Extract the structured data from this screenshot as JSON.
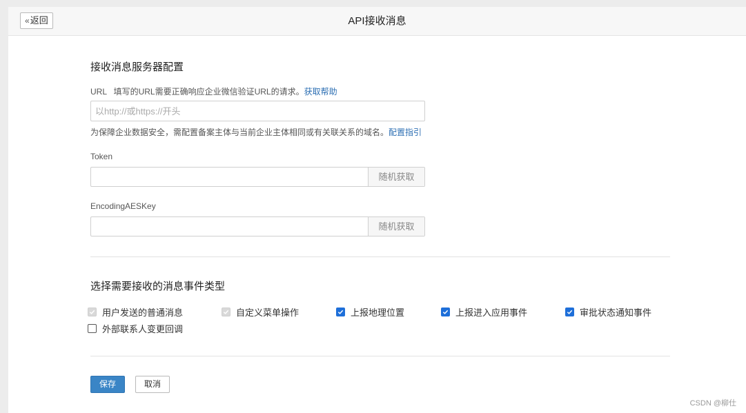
{
  "header": {
    "back_label": "返回",
    "title": "API接收消息"
  },
  "server_config": {
    "section_title": "接收消息服务器配置",
    "url": {
      "label": "URL",
      "hint": "填写的URL需要正确响应企业微信验证URL的请求。",
      "help_link": "获取帮助",
      "placeholder": "以http://或https://开头",
      "value": "",
      "note": "为保障企业数据安全，需配置备案主体与当前企业主体相同或有关联关系的域名。",
      "guide_link": "配置指引"
    },
    "token": {
      "label": "Token",
      "value": "",
      "random_button": "随机获取"
    },
    "aes_key": {
      "label": "EncodingAESKey",
      "value": "",
      "random_button": "随机获取"
    }
  },
  "event_types": {
    "section_title": "选择需要接收的消息事件类型",
    "options": [
      {
        "label": "用户发送的普通消息",
        "state": "checked-disabled"
      },
      {
        "label": "自定义菜单操作",
        "state": "checked-disabled"
      },
      {
        "label": "上报地理位置",
        "state": "checked"
      },
      {
        "label": "上报进入应用事件",
        "state": "checked"
      },
      {
        "label": "审批状态通知事件",
        "state": "checked"
      },
      {
        "label": "外部联系人变更回调",
        "state": "unchecked"
      }
    ]
  },
  "actions": {
    "save_label": "保存",
    "cancel_label": "取消"
  },
  "watermark": "CSDN @柳仕",
  "colors": {
    "primary": "#3a85c6",
    "link": "#2d6fb3",
    "checkbox": "#1e6fd9"
  }
}
